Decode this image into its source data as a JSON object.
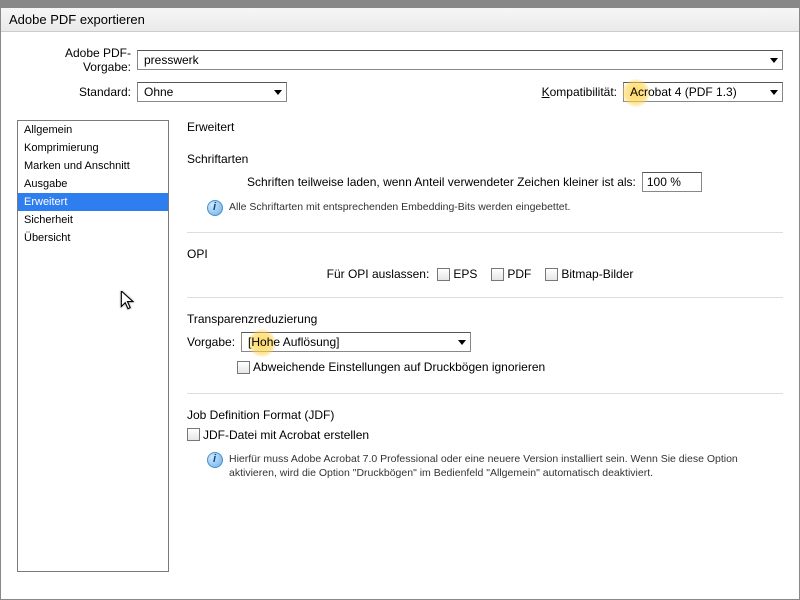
{
  "title": "Adobe PDF exportieren",
  "top": {
    "presetLabel": "Adobe PDF-Vorgabe:",
    "presetValue": "presswerk",
    "standardLabel": "Standard:",
    "standardValue": "Ohne",
    "compatLabel": "Kompatibilität:",
    "compatLabelUnderline": "K",
    "compatValue": "Acrobat 4 (PDF 1.3)"
  },
  "sidebar": {
    "items": [
      "Allgemein",
      "Komprimierung",
      "Marken und Anschnitt",
      "Ausgabe",
      "Erweitert",
      "Sicherheit",
      "Übersicht"
    ],
    "selectedIndex": 4
  },
  "content": {
    "heading": "Erweitert",
    "fonts": {
      "title": "Schriftarten",
      "subsetLabel": "Schriften teilweise laden, wenn Anteil verwendeter Zeichen kleiner ist als:",
      "subsetValue": "100 %",
      "info": "Alle Schriftarten mit entsprechenden Embedding-Bits werden eingebettet."
    },
    "opi": {
      "title": "OPI",
      "omitLabel": "Für OPI auslassen:",
      "eps": "EPS",
      "pdf": "PDF",
      "bitmap": "Bitmap-Bilder"
    },
    "transparency": {
      "title": "Transparenzreduzierung",
      "presetLabel": "Vorgabe:",
      "presetValue": "[Hohe Auflösung]",
      "ignoreLabel": "Abweichende Einstellungen auf Druckbögen ignorieren"
    },
    "jdf": {
      "title": "Job Definition Format (JDF)",
      "createLabel": "JDF-Datei mit Acrobat erstellen",
      "info": "Hierfür muss Adobe Acrobat 7.0 Professional oder eine neuere Version installiert sein. Wenn Sie diese Option aktivieren, wird die Option \"Druckbögen\" im Bedienfeld \"Allgemein\" automatisch deaktiviert."
    }
  }
}
